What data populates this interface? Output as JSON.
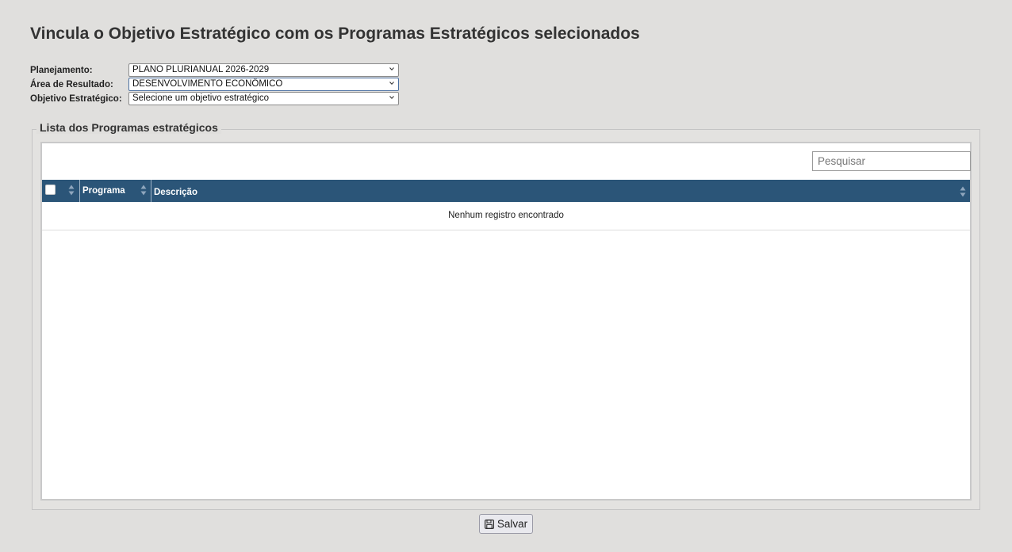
{
  "page": {
    "title": "Vincula o Objetivo Estratégico com os Programas Estratégicos selecionados"
  },
  "form": {
    "planejamento": {
      "label": "Planejamento:",
      "value": "PLANO PLURIANUAL 2026-2029"
    },
    "area_resultado": {
      "label": "Área de Resultado:",
      "value": "DESENVOLVIMENTO ECONÔMICO"
    },
    "objetivo": {
      "label": "Objetivo Estratégico:",
      "value": "Selecione um objetivo estratégico"
    }
  },
  "list": {
    "legend": "Lista dos Programas estratégicos",
    "search_placeholder": "Pesquisar",
    "columns": {
      "programa": "Programa",
      "descricao": "Descrição"
    },
    "empty_message": "Nenhum registro encontrado"
  },
  "actions": {
    "save_label": "Salvar"
  },
  "colors": {
    "header_bg": "#2b5578",
    "page_bg": "#e0dfdd"
  },
  "icons": {
    "select_arrow": "chevron-down-icon",
    "sort": "sort-icon",
    "save": "floppy-disk-icon"
  }
}
